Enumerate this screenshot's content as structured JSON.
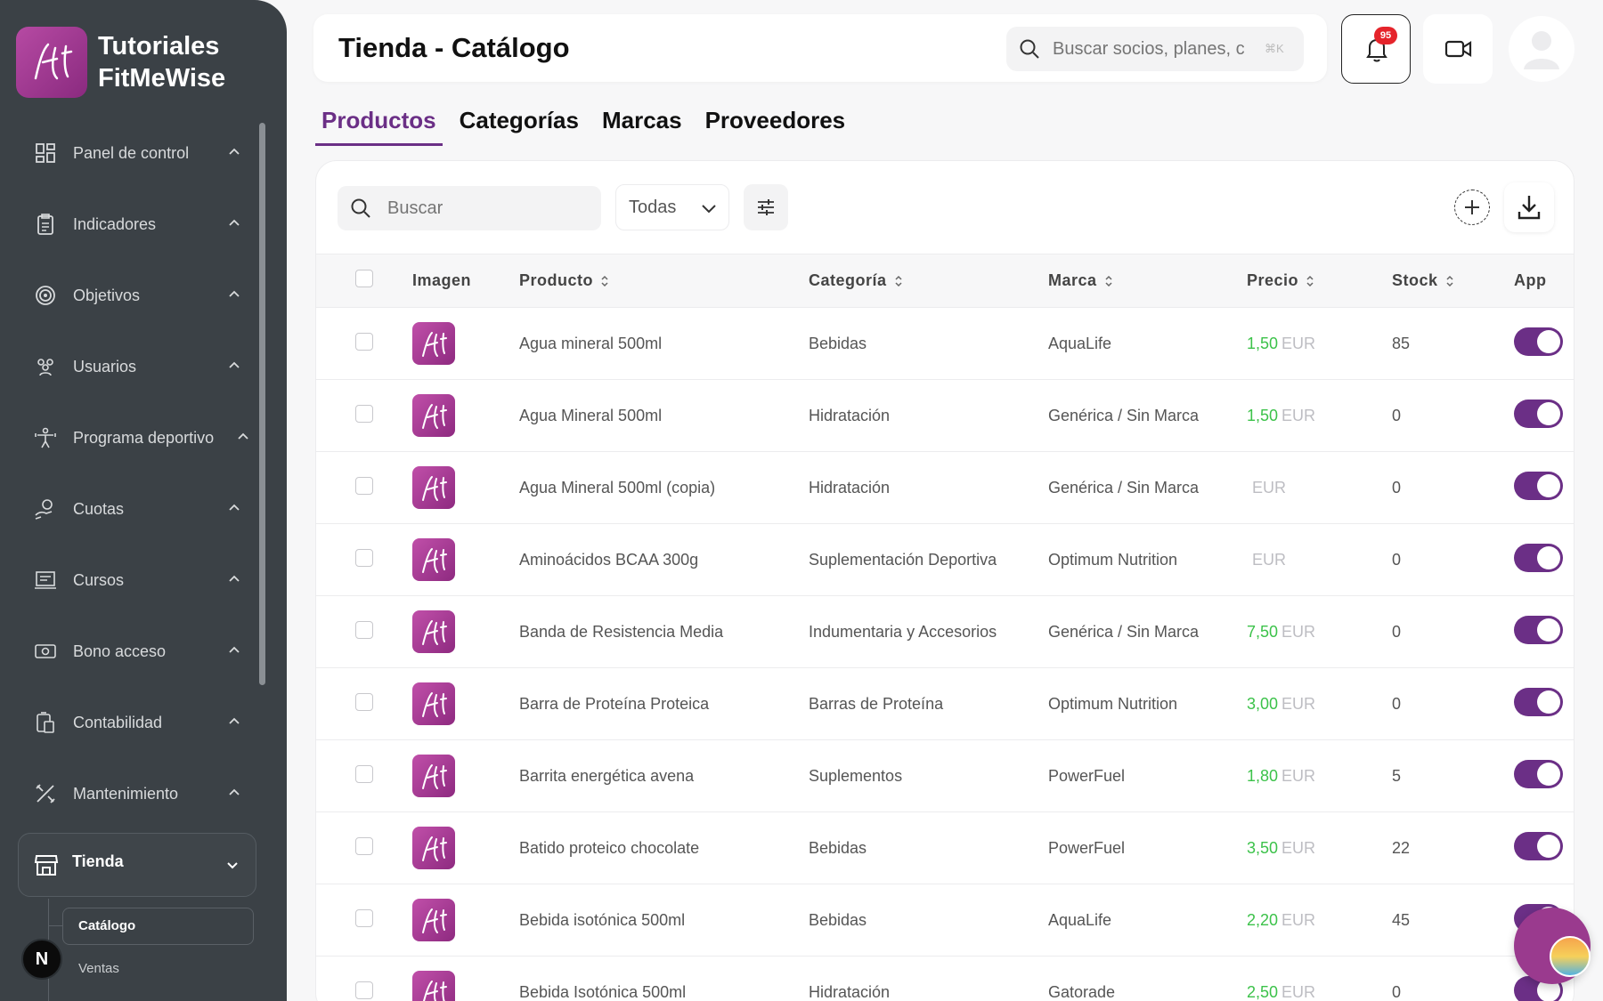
{
  "brand": {
    "line1": "Tutoriales",
    "line2": "FitMeWise"
  },
  "sidebar": {
    "items": [
      {
        "label": "Panel de control",
        "icon": "dashboard-icon"
      },
      {
        "label": "Indicadores",
        "icon": "clipboard-icon"
      },
      {
        "label": "Objetivos",
        "icon": "target-icon"
      },
      {
        "label": "Usuarios",
        "icon": "users-icon"
      },
      {
        "label": "Programa deportivo",
        "icon": "fitness-icon"
      },
      {
        "label": "Cuotas",
        "icon": "payment-icon"
      },
      {
        "label": "Cursos",
        "icon": "course-icon"
      },
      {
        "label": "Bono acceso",
        "icon": "money-icon"
      },
      {
        "label": "Contabilidad",
        "icon": "accounting-icon"
      },
      {
        "label": "Mantenimiento",
        "icon": "tools-icon"
      }
    ],
    "active": {
      "label": "Tienda",
      "icon": "store-icon"
    },
    "sub_items": {
      "active": "Catálogo",
      "other": "Ventas"
    },
    "n_badge": "N"
  },
  "header": {
    "title": "Tienda - Catálogo",
    "search_placeholder": "Buscar socios, planes, c",
    "search_kbd": "⌘K",
    "notifications": "95"
  },
  "tabs": [
    "Productos",
    "Categorías",
    "Marcas",
    "Proveedores"
  ],
  "toolbar": {
    "search_placeholder": "Buscar",
    "category_filter": "Todas"
  },
  "table": {
    "headers": {
      "image": "Imagen",
      "product": "Producto",
      "category": "Categoría",
      "brand": "Marca",
      "price": "Precio",
      "stock": "Stock",
      "app": "App"
    },
    "currency": "EUR",
    "rows": [
      {
        "product": "Agua mineral 500ml",
        "category": "Bebidas",
        "brand": "AquaLife",
        "price": "1,50",
        "stock": "85",
        "app": true
      },
      {
        "product": "Agua Mineral 500ml",
        "category": "Hidratación",
        "brand": "Genérica / Sin Marca",
        "price": "1,50",
        "stock": "0",
        "app": true
      },
      {
        "product": "Agua Mineral 500ml (copia)",
        "category": "Hidratación",
        "brand": "Genérica / Sin Marca",
        "price": "",
        "stock": "0",
        "app": true
      },
      {
        "product": "Aminoácidos BCAA 300g",
        "category": "Suplementación Deportiva",
        "brand": "Optimum Nutrition",
        "price": "",
        "stock": "0",
        "app": true
      },
      {
        "product": "Banda de Resistencia Media",
        "category": "Indumentaria y Accesorios",
        "brand": "Genérica / Sin Marca",
        "price": "7,50",
        "stock": "0",
        "app": true
      },
      {
        "product": "Barra de Proteína Proteica",
        "category": "Barras de Proteína",
        "brand": "Optimum Nutrition",
        "price": "3,00",
        "stock": "0",
        "app": true
      },
      {
        "product": "Barrita energética avena",
        "category": "Suplementos",
        "brand": "PowerFuel",
        "price": "1,80",
        "stock": "5",
        "app": true
      },
      {
        "product": "Batido proteico chocolate",
        "category": "Bebidas",
        "brand": "PowerFuel",
        "price": "3,50",
        "stock": "22",
        "app": true
      },
      {
        "product": "Bebida isotónica 500ml",
        "category": "Bebidas",
        "brand": "AquaLife",
        "price": "2,20",
        "stock": "45",
        "app": true
      },
      {
        "product": "Bebida Isotónica 500ml",
        "category": "Hidratación",
        "brand": "Gatorade",
        "price": "2,50",
        "stock": "0",
        "app": true
      }
    ]
  },
  "colors": {
    "accent": "#6b2f86",
    "price_green": "#3cc24a",
    "sidebar_bg": "#3b4146",
    "badge_red": "#e5242b"
  }
}
